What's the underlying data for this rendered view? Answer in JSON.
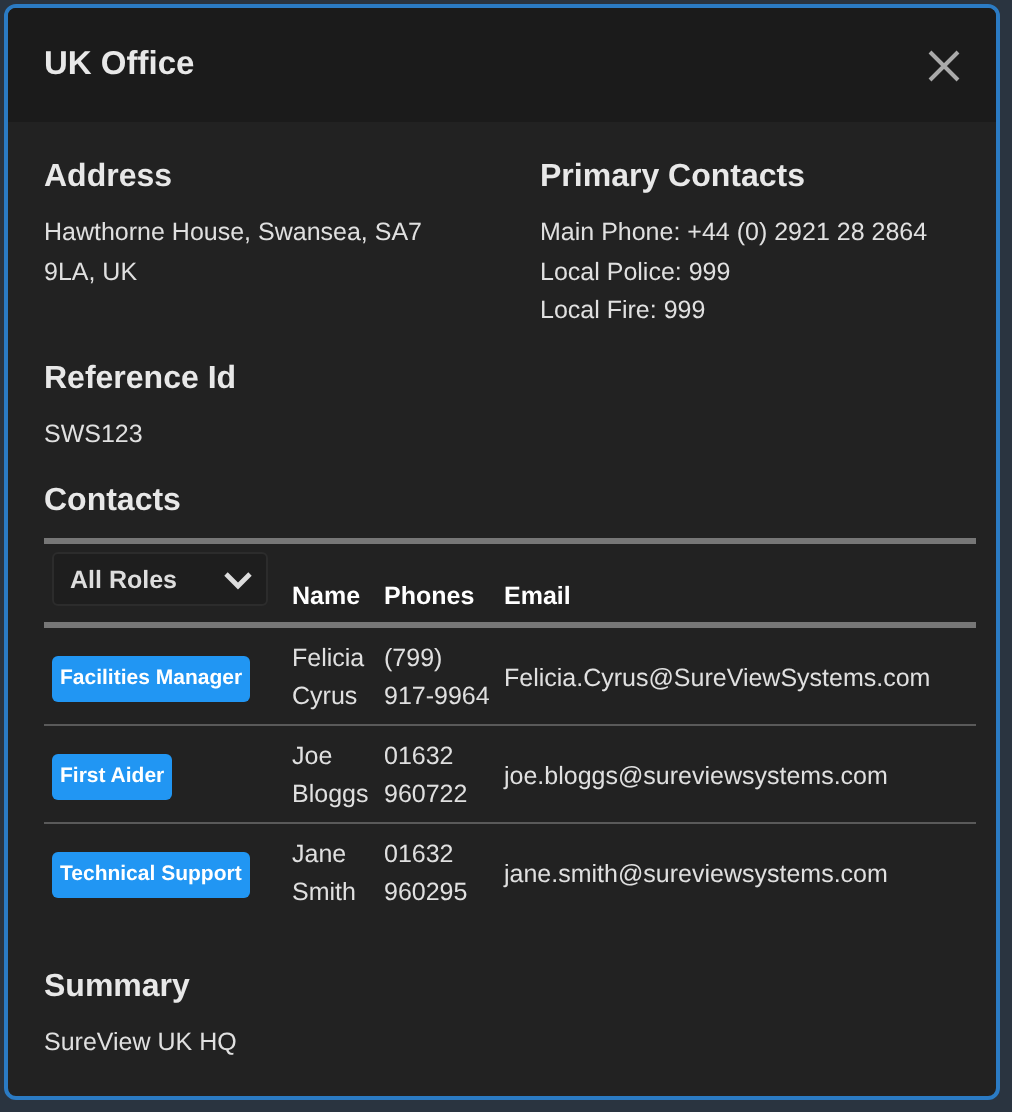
{
  "dialog": {
    "title": "UK Office"
  },
  "address": {
    "heading": "Address",
    "text": "Hawthorne House, Swansea, SA7 9LA, UK"
  },
  "primary_contacts": {
    "heading": "Primary Contacts",
    "lines": [
      "Main Phone: +44 (0) 2921 28 2864",
      "Local Police: 999",
      "Local Fire: 999"
    ]
  },
  "reference": {
    "heading": "Reference Id",
    "text": "SWS123"
  },
  "contacts": {
    "heading": "Contacts",
    "role_filter": "All Roles",
    "columns": [
      "Name",
      "Phones",
      "Email"
    ],
    "rows": [
      {
        "role": "Facilities Manager",
        "name": "Felicia Cyrus",
        "phones": "(799) 917-9964",
        "email": "Felicia.Cyrus@SureViewSystems.com"
      },
      {
        "role": "First Aider",
        "name": "Joe Bloggs",
        "phones": "01632 960722",
        "email": "joe.bloggs@sureviewsystems.com"
      },
      {
        "role": "Technical Support",
        "name": "Jane Smith",
        "phones": "01632 960295",
        "email": "jane.smith@sureviewsystems.com"
      }
    ]
  },
  "summary": {
    "heading": "Summary",
    "text": "SureView UK HQ"
  }
}
